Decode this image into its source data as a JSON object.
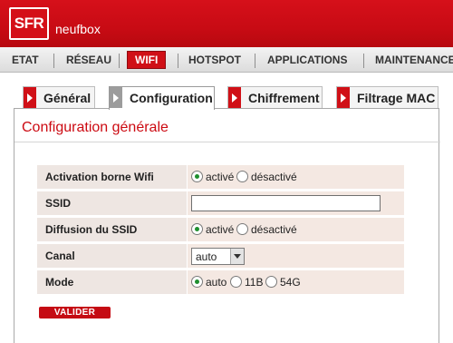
{
  "header": {
    "logo": "SFR",
    "brand": "neufbox"
  },
  "nav": {
    "items": [
      {
        "label": "ETAT"
      },
      {
        "label": "RÉSEAU"
      },
      {
        "label": "WIFI",
        "active": true
      },
      {
        "label": "HOTSPOT"
      },
      {
        "label": "APPLICATIONS"
      },
      {
        "label": "MAINTENANCE"
      }
    ]
  },
  "subtabs": [
    {
      "label": "Général"
    },
    {
      "label": "Configuration",
      "active": true
    },
    {
      "label": "Chiffrement"
    },
    {
      "label": "Filtrage MAC"
    }
  ],
  "page": {
    "title": "Configuration générale",
    "rows": [
      {
        "label": "Activation borne Wifi",
        "options": [
          "activé",
          "désactivé"
        ],
        "selected": "activé"
      },
      {
        "label": "SSID",
        "value": ""
      },
      {
        "label": "Diffusion du SSID",
        "options": [
          "activé",
          "désactivé"
        ],
        "selected": "activé"
      },
      {
        "label": "Canal",
        "value": "auto"
      },
      {
        "label": "Mode",
        "options": [
          "auto",
          "11B",
          "54G"
        ],
        "selected": "auto"
      }
    ],
    "submit_label": "VALIDER"
  },
  "colors": {
    "brand_red": "#d01017",
    "row_bg": "#f4e8e2",
    "radio_selected": "#1f8f2f"
  }
}
